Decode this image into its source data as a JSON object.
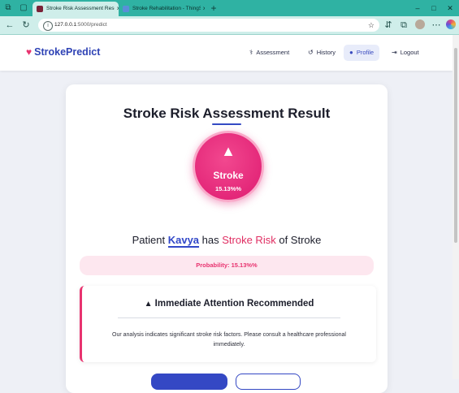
{
  "browser": {
    "tabs": [
      {
        "title": "Stroke Risk Assessment Results |",
        "active": true,
        "favicon_color": "#7a2238"
      },
      {
        "title": "Stroke Rehabilitation - ThingSpea",
        "active": false,
        "favicon_color": "#5a8fd8"
      }
    ],
    "new_tab_label": "+",
    "close_label": "×",
    "url_host": "127.0.0.1",
    "url_path": ":5000/predict",
    "window_controls": [
      "–",
      "□",
      "✕"
    ]
  },
  "header": {
    "brand": "StrokePredict",
    "nav": [
      {
        "label": "Assessment",
        "icon": "stethoscope-icon",
        "glyph": "⚕"
      },
      {
        "label": "History",
        "icon": "history-icon",
        "glyph": "↺"
      },
      {
        "label": "Profile",
        "icon": "user-icon",
        "glyph": "●",
        "active": true
      },
      {
        "label": "Logout",
        "icon": "logout-icon",
        "glyph": "⇥"
      }
    ]
  },
  "result": {
    "title": "Stroke Risk Assessment Result",
    "circle_label": "Stroke",
    "circle_percent": "15.13%%",
    "patient_prefix": "Patient",
    "patient_name": "Kavya",
    "patient_has": "has",
    "risk_label": "Stroke Risk",
    "patient_suffix": "of Stroke",
    "probability": "Probability: 15.13%%"
  },
  "alert": {
    "title": "Immediate Attention Recommended",
    "text": "Our analysis indicates significant stroke risk factors. Please consult a healthcare professional immediately."
  },
  "colors": {
    "accent": "#3448c4",
    "danger": "#e8336f",
    "browser_chrome": "#2fb2a3"
  }
}
